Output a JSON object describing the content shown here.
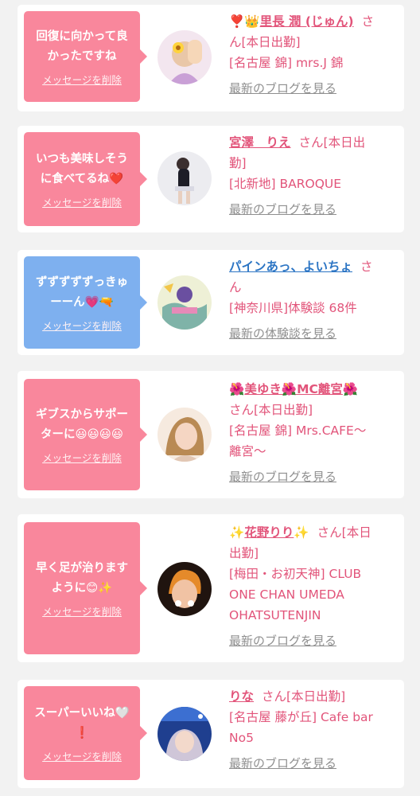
{
  "delete_label": "メッセージを削除",
  "items": [
    {
      "bubble_lines": [
        "回復に向かって良",
        "かったですね"
      ],
      "bubble_color": "#f9879c",
      "name_prefix": "❣️👑",
      "name": "里長 潤 (じゅん)",
      "name_suffix": "",
      "san": "さ",
      "info_lines": [
        "ん[本日出勤]",
        "[名古屋 錦] mrs.J 錦"
      ],
      "link": "最新のブログを見る"
    },
    {
      "bubble_lines": [
        "いつも美味しそう",
        "に食べてるね❤️"
      ],
      "bubble_color": "#f9879c",
      "name_prefix": "",
      "name": "宮澤　りえ",
      "name_suffix": "",
      "san": "さん[本日出",
      "info_lines": [
        "勤]",
        "[北新地] BAROQUE"
      ],
      "link": "最新のブログを見る"
    },
    {
      "bubble_lines": [
        "ずずずずずっきゅ",
        "ーーん💗🔫"
      ],
      "bubble_color": "#7eb0ef",
      "name_prefix": "",
      "name": "パインあっ、よいちょ",
      "name_suffix": "",
      "san": "さ",
      "info_lines": [
        "ん",
        "[神奈川県]体験談 68件"
      ],
      "link": "最新の体験談を見る"
    },
    {
      "bubble_lines": [
        "ギブスからサポー",
        "ターに😃😃😃😃"
      ],
      "bubble_color": "#f9879c",
      "name_prefix": "🌺",
      "name": "美ゆき🌺MC離宮",
      "name_suffix": "🌺",
      "san": "",
      "info_lines": [
        "さん[本日出勤]",
        "[名古屋 錦] Mrs.CAFE〜",
        "離宮〜"
      ],
      "link": "最新のブログを見る"
    },
    {
      "bubble_lines": [
        "早く足が治ります",
        "ように😊✨"
      ],
      "bubble_color": "#f9879c",
      "name_prefix": "✨",
      "name": "花野りり",
      "name_suffix": "✨",
      "san": "さん[本日",
      "info_lines": [
        "出勤]",
        "[梅田・お初天神] CLUB",
        "ONE CHAN UMEDA",
        "OHATSUTENJIN"
      ],
      "link": "最新のブログを見る"
    },
    {
      "bubble_lines": [
        "スーパーいいね🤍",
        "❗"
      ],
      "bubble_color": "#f9879c",
      "name_prefix": "",
      "name": "りな",
      "name_suffix": "",
      "san": "さん[本日出勤]",
      "info_lines": [
        "[名古屋 藤が丘] Cafe bar",
        "No5"
      ],
      "link": "最新のブログを見る"
    }
  ]
}
